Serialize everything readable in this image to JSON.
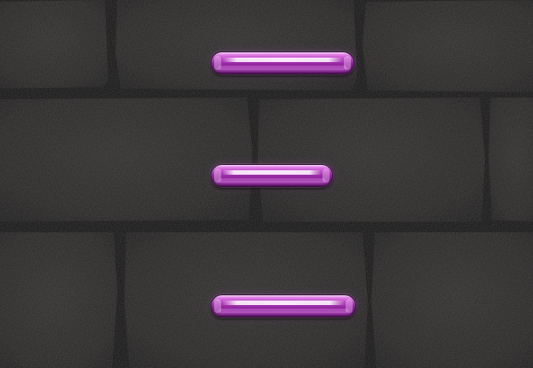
{
  "theme": {
    "wall_color": "#1b1a1a",
    "mortar_color": "#0e0d0d",
    "tube_color": "#b044bc"
  },
  "bars": [
    {
      "name": "top-bar"
    },
    {
      "name": "middle-bar"
    },
    {
      "name": "bottom-bar"
    }
  ]
}
